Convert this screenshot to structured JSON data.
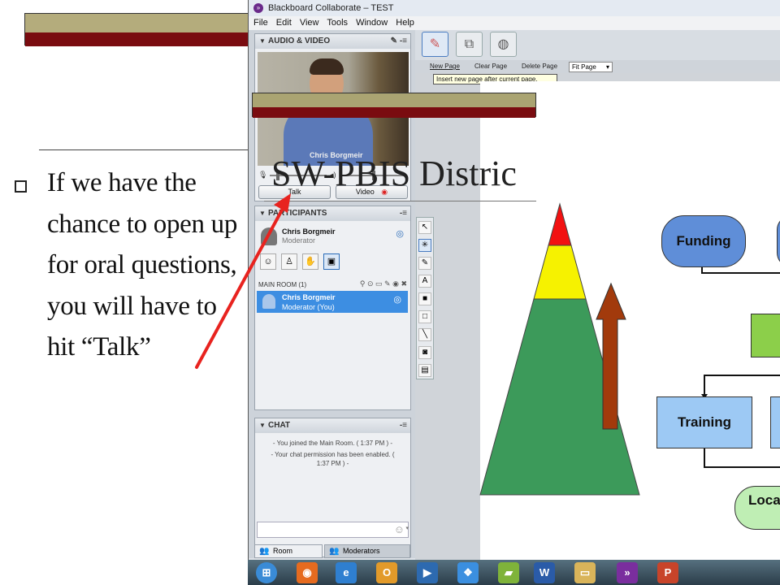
{
  "slide": {
    "bullet_text": "If we have the chance to open up for oral questions, you will have to hit “Talk”"
  },
  "window": {
    "title": "Blackboard Collaborate – TEST",
    "menu": [
      "File",
      "Edit",
      "View",
      "Tools",
      "Window",
      "Help"
    ]
  },
  "audio_video": {
    "header": "AUDIO & VIDEO",
    "speaker_name": "Chris Borgmeir",
    "talk_label": "Talk",
    "video_label": "Video"
  },
  "participants": {
    "header": "PARTICIPANTS",
    "me_name": "Chris Borgmeir",
    "me_role": "Moderator",
    "room_label": "MAIN ROOM (1)",
    "room_user_name": "Chris Borgmeir",
    "room_user_role": "Moderator (You)"
  },
  "chat": {
    "header": "CHAT",
    "messages": [
      "- You joined the Main Room. ( 1:37 PM ) -",
      "- Your chat permission has been enabled. ( 1:37 PM ) -"
    ],
    "tab_room": "Room",
    "tab_moderators": "Moderators"
  },
  "whiteboard": {
    "new_page": "New Page",
    "clear_page": "Clear Page",
    "delete_page": "Delete Page",
    "fit_page": "Fit Page",
    "tooltip": "Insert new page after current page.",
    "page_title": "SW-PBIS Distric",
    "nodes": {
      "funding": "Funding",
      "training": "Training",
      "local": "Loca"
    }
  },
  "colors": {
    "selection_blue": "#3d8ee2",
    "slide_maroon": "#7a0c10",
    "slide_khaki": "#b4ac7c",
    "arrow_red": "#e8231f"
  }
}
